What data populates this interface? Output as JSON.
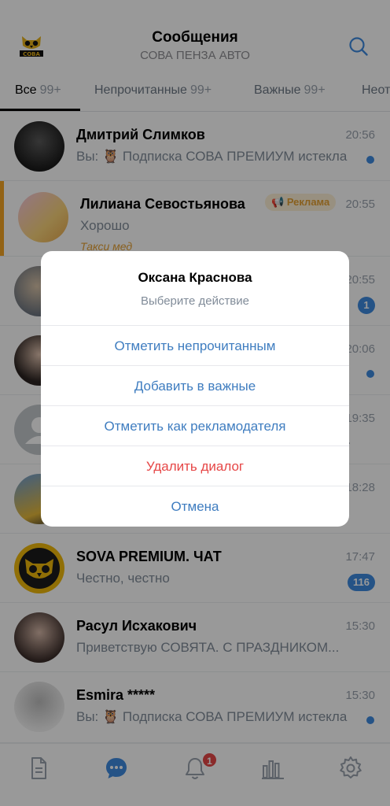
{
  "header": {
    "title": "Сообщения",
    "subtitle": "СОВА ПЕНЗА АВТО",
    "logo_text": "СОВА"
  },
  "tabs": [
    {
      "label": "Все",
      "count": "99+",
      "active": true
    },
    {
      "label": "Непрочитанные",
      "count": "99+",
      "active": false
    },
    {
      "label": "Важные",
      "count": "99+",
      "active": false
    },
    {
      "label": "Неот",
      "count": "",
      "active": false
    }
  ],
  "chats": [
    {
      "name": "Дмитрий Слимков",
      "time": "20:56",
      "message": "Вы: 🦉 Подписка СОВА ПРЕМИУМ истекла",
      "indicator": "dot"
    },
    {
      "name": "Лилиана Севостьянова",
      "time": "20:55",
      "message": "Хорошо",
      "sub": "Такси мед",
      "ad_label": "Реклама"
    },
    {
      "name": "",
      "time": "20:55",
      "message": "",
      "badge": "1"
    },
    {
      "name": "",
      "time": "20:06",
      "message": "",
      "indicator": "dot"
    },
    {
      "name": "",
      "time": "19:35",
      "message": "..."
    },
    {
      "name": "",
      "time": "18:28",
      "message": ""
    },
    {
      "name": "SOVA PREMIUM. ЧАТ",
      "time": "17:47",
      "message": "Честно, честно",
      "badge": "116"
    },
    {
      "name": "Расул Исхакович",
      "time": "15:30",
      "message": "Приветствую СОВЯТА. С ПРАЗДНИКОМ..."
    },
    {
      "name": "Esmira *****",
      "time": "15:30",
      "message": "Вы: 🦉 Подписка СОВА ПРЕМИУМ истекла",
      "indicator": "dot"
    }
  ],
  "bottom_nav": {
    "notifications_badge": "1",
    "items": [
      "document-icon",
      "messages-icon",
      "bell-icon",
      "stats-icon",
      "gear-icon"
    ]
  },
  "dialog": {
    "title": "Оксана Краснова",
    "subtitle": "Выберите действие",
    "actions": [
      {
        "label": "Отметить непрочитанным"
      },
      {
        "label": "Добавить в важные"
      },
      {
        "label": "Отметить как рекламодателя"
      },
      {
        "label": "Удалить диалог",
        "danger": true
      },
      {
        "label": "Отмена"
      }
    ]
  },
  "colors": {
    "accent": "#3f8ae0",
    "danger": "#e64646",
    "ad": "#f5a623"
  }
}
